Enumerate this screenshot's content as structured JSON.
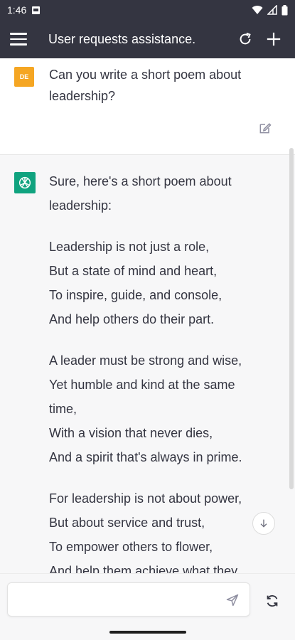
{
  "status_bar": {
    "time": "1:46"
  },
  "app_bar": {
    "title": "User requests assistance."
  },
  "user_message": {
    "avatar_initials": "DE",
    "text": "Can you write a short poem about leadership?"
  },
  "assistant_message": {
    "intro": "Sure, here's a short poem about leadership:",
    "stanzas": [
      [
        "Leadership is not just a role,",
        "But a state of mind and heart,",
        "To inspire, guide, and console,",
        "And help others do their part."
      ],
      [
        "A leader must be strong and wise,",
        "Yet humble and kind at the same time,",
        "With a vision that never dies,",
        "And a spirit that's always in prime."
      ],
      [
        "For leadership is not about power,",
        "But about service and trust,",
        "To empower others to flower,",
        "And help them achieve what they"
      ]
    ]
  },
  "input": {
    "placeholder": "",
    "value": ""
  },
  "icons": {
    "menu": "menu-icon",
    "refresh": "refresh-icon",
    "add": "plus-icon",
    "edit": "edit-icon",
    "send": "send-icon",
    "regenerate": "regenerate-icon",
    "scroll_down": "arrow-down-icon"
  },
  "colors": {
    "app_bar": "#343541",
    "user_avatar": "#f5a623",
    "assistant_avatar": "#10a37f",
    "assistant_bg": "#f7f7f8"
  }
}
